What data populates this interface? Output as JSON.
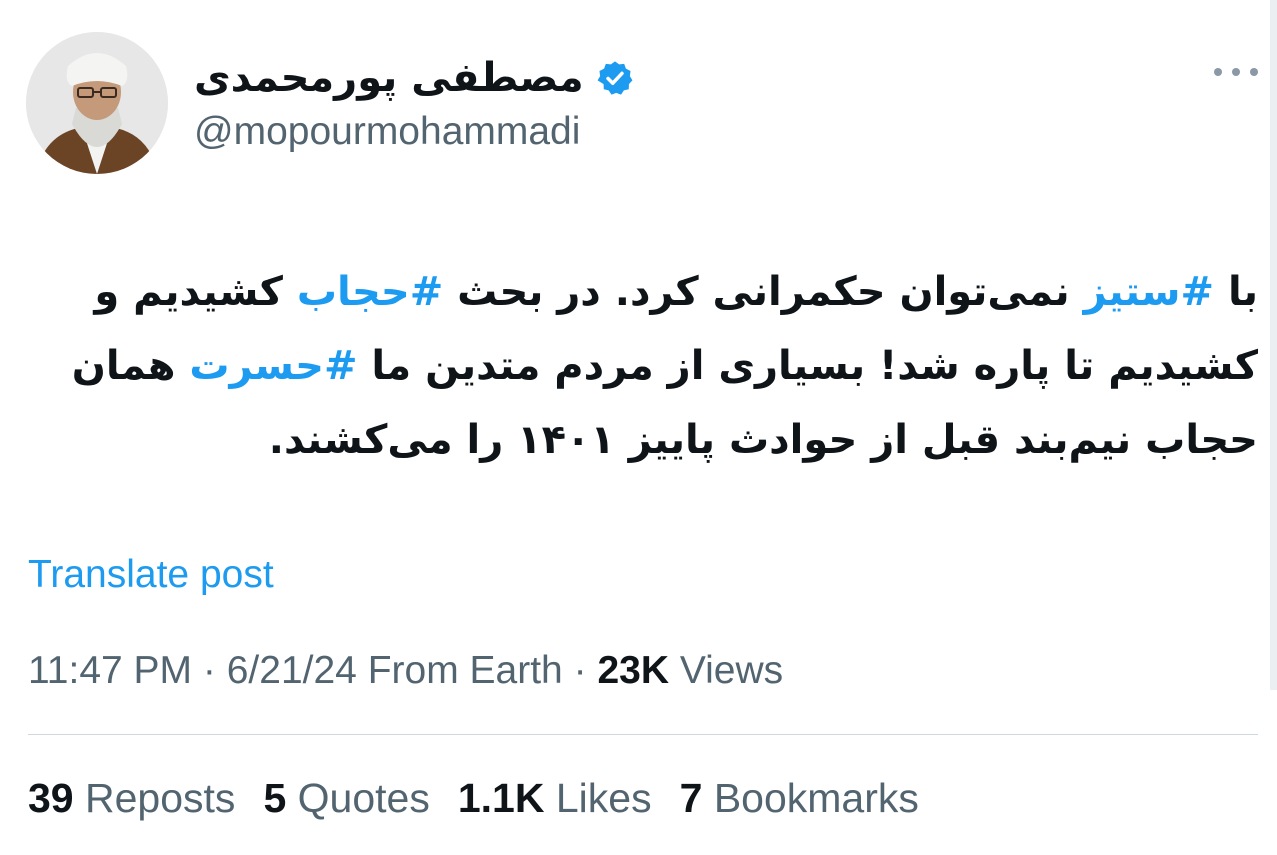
{
  "author": {
    "display_name": "مصطفی پورمحمدی",
    "handle": "@mopourmohammadi",
    "verified": true
  },
  "icons": {
    "verified": "verified-badge-icon",
    "more": "more-options-icon",
    "avatar": "profile-photo"
  },
  "tweet": {
    "segments": [
      {
        "text": "با ",
        "type": "text"
      },
      {
        "text": "#ستیز",
        "type": "hashtag"
      },
      {
        "text": " نمی‌توان حکمرانی کرد. در بحث ",
        "type": "text"
      },
      {
        "text": "#حجاب",
        "type": "hashtag"
      },
      {
        "text": " کشیدیم و کشیدیم تا پاره شد! بسیاری از مردم متدین ما ",
        "type": "text"
      },
      {
        "text": "#حسرت",
        "type": "hashtag"
      },
      {
        "text": " همان حجاب نیم‌بند قبل از حوادث پاییز ۱۴۰۱ را می‌کشند.",
        "type": "text"
      }
    ]
  },
  "translate_label": "Translate post",
  "meta": {
    "time": "11:47 PM",
    "date": "6/21/24",
    "source": "From Earth",
    "separator": "·",
    "views_count": "23K",
    "views_label": "Views"
  },
  "stats": [
    {
      "count": "39",
      "label": "Reposts"
    },
    {
      "count": "5",
      "label": "Quotes"
    },
    {
      "count": "1.1K",
      "label": "Likes"
    },
    {
      "count": "7",
      "label": "Bookmarks"
    }
  ],
  "colors": {
    "link": "#1d9bf0",
    "secondary_text": "#536471",
    "primary_text": "#0f1419",
    "divider": "#cfd9de"
  }
}
